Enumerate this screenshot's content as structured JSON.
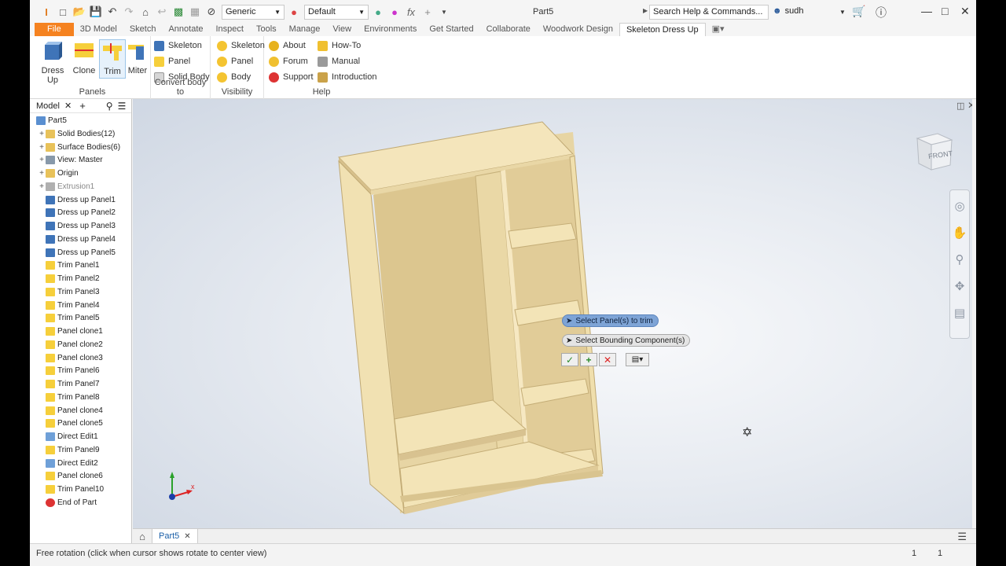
{
  "quick_access": {
    "material": "Generic",
    "appearance": "Default",
    "doc_title": "Part5",
    "search_placeholder": "Search Help & Commands...",
    "user": "sudh"
  },
  "tabs": [
    "File",
    "3D Model",
    "Sketch",
    "Annotate",
    "Inspect",
    "Tools",
    "Manage",
    "View",
    "Environments",
    "Get Started",
    "Collaborate",
    "Woodwork Design",
    "Skeleton Dress Up"
  ],
  "ribbon": {
    "panels_group": {
      "label": "Panels",
      "buttons": [
        "Dress Up",
        "Clone",
        "Trim",
        "Miter"
      ]
    },
    "convert_group": {
      "label": "Convert body to",
      "buttons": [
        "Skeleton",
        "Panel",
        "Solid Body"
      ]
    },
    "visibility_group": {
      "label": "Visibility",
      "buttons": [
        "Skeleton",
        "Panel",
        "Body"
      ]
    },
    "help_group": {
      "label": "Help",
      "col1": [
        "About",
        "Forum",
        "Support"
      ],
      "col2": [
        "How-To",
        "Manual",
        "Introduction"
      ]
    }
  },
  "browser": {
    "title": "Model",
    "items": [
      {
        "label": "Part5",
        "type": "part"
      },
      {
        "label": "Solid Bodies(12)",
        "type": "folder"
      },
      {
        "label": "Surface Bodies(6)",
        "type": "folder"
      },
      {
        "label": "View: Master",
        "type": "view"
      },
      {
        "label": "Origin",
        "type": "folder"
      },
      {
        "label": "Extrusion1",
        "type": "extrusion"
      },
      {
        "label": "Dress up Panel1",
        "type": "dress"
      },
      {
        "label": "Dress up Panel2",
        "type": "dress"
      },
      {
        "label": "Dress up Panel3",
        "type": "dress"
      },
      {
        "label": "Dress up Panel4",
        "type": "dress"
      },
      {
        "label": "Dress up Panel5",
        "type": "dress"
      },
      {
        "label": "Trim Panel1",
        "type": "trim"
      },
      {
        "label": "Trim Panel2",
        "type": "trim"
      },
      {
        "label": "Trim Panel3",
        "type": "trim"
      },
      {
        "label": "Trim Panel4",
        "type": "trim"
      },
      {
        "label": "Trim Panel5",
        "type": "trim"
      },
      {
        "label": "Panel clone1",
        "type": "clone"
      },
      {
        "label": "Panel clone2",
        "type": "clone"
      },
      {
        "label": "Panel clone3",
        "type": "clone"
      },
      {
        "label": "Trim Panel6",
        "type": "trim"
      },
      {
        "label": "Trim Panel7",
        "type": "trim"
      },
      {
        "label": "Trim Panel8",
        "type": "trim"
      },
      {
        "label": "Panel clone4",
        "type": "clone"
      },
      {
        "label": "Panel clone5",
        "type": "clone"
      },
      {
        "label": "Direct Edit1",
        "type": "direct"
      },
      {
        "label": "Trim Panel9",
        "type": "trim"
      },
      {
        "label": "Direct Edit2",
        "type": "direct"
      },
      {
        "label": "Panel clone6",
        "type": "clone"
      },
      {
        "label": "Trim Panel10",
        "type": "trim"
      },
      {
        "label": "End of Part",
        "type": "end"
      }
    ]
  },
  "minitoolbar": {
    "select_panels": "Select Panel(s) to trim",
    "select_bounding": "Select Bounding Component(s)"
  },
  "viewcube": {
    "face": "FRONT"
  },
  "document_tab": "Part5",
  "status": {
    "message": "Free rotation (click when cursor shows rotate to center view)",
    "count1": "1",
    "count2": "1"
  },
  "colors": {
    "file_tab": "#f58220",
    "wood_light": "#f5e6bd",
    "wood_mid": "#e9d6a3",
    "wood_dark": "#d6c08c"
  }
}
